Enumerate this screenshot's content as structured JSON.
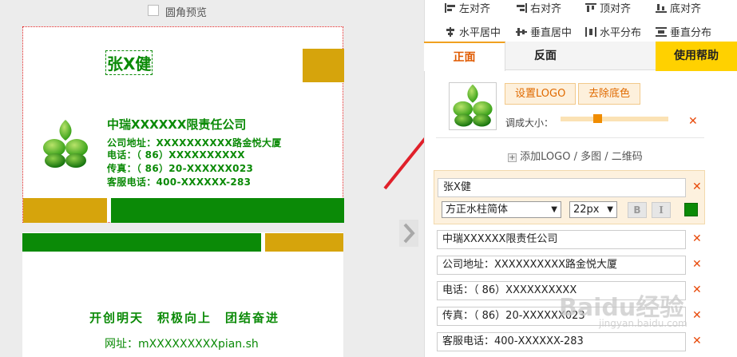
{
  "preview": {
    "rounded_label": "圆角预览"
  },
  "card_front": {
    "name": "张X健",
    "company": "中瑞XXXXXX限责任公司",
    "address": "公司地址：XXXXXXXXXX路金悦大厦",
    "phone": "电话：（ 86）XXXXXXXXXX",
    "fax": "传真：（ 86）20-XXXXXX023",
    "service": "客服电话：400-XXXXXX-283"
  },
  "card_back": {
    "slogan": "开创明天　积极向上　团结奋进",
    "url": "网址：mXXXXXXXXXpian.sh"
  },
  "toolbar": {
    "align_left": "左对齐",
    "align_right": "右对齐",
    "align_top": "顶对齐",
    "align_bottom": "底对齐",
    "h_center": "水平居中",
    "v_center": "垂直居中",
    "h_distribute": "水平分布",
    "v_distribute": "垂直分布"
  },
  "tabs": {
    "front": "正面",
    "back": "反面",
    "help": "使用帮助"
  },
  "logo": {
    "set_logo": "设置LOGO",
    "remove_bg": "去除底色",
    "size_label": "调成大小：",
    "size_level": 0.33,
    "add_logo": "添加LOGO / 多图 / 二维码"
  },
  "fields": {
    "name_value": "张X健",
    "font_value": "方正水柱简体",
    "size_value": "22px",
    "bold": "B",
    "italic": "I",
    "text_color": "#0b8a07",
    "company_value": "中瑞XXXXXX限责任公司",
    "address_value": "公司地址：XXXXXXXXXX路金悦大厦",
    "phone_value": "电话：（ 86）XXXXXXXXXX",
    "fax_value": "传真：（ 86）20-XXXXXX023",
    "service_value": "客服电话：400-XXXXXX-283"
  },
  "watermark": {
    "brand": "Baidu经验",
    "sub": "jingyan.baidu.com"
  }
}
